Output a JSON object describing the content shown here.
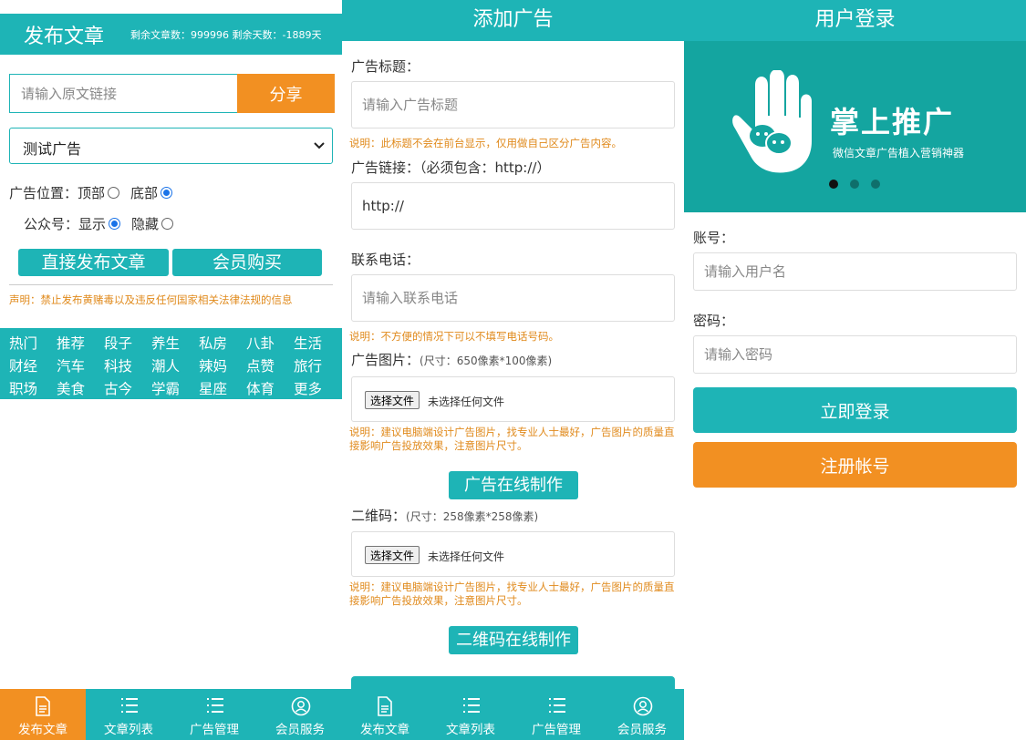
{
  "colors": {
    "teal": "#1eb4b6",
    "orange": "#f29022",
    "notice": "#e08a1c"
  },
  "publish": {
    "title": "发布文章",
    "stats": "剩余文章数：999996 剩余天数：-1889天",
    "link_placeholder": "请输入原文链接",
    "share_label": "分享",
    "ad_selected": "测试广告",
    "ad_position_label": "广告位置：",
    "ad_position_top": "顶部",
    "ad_position_bottom": "底部",
    "ad_position_selected": "底部",
    "account_label": "公众号：",
    "account_show": "显示",
    "account_hide": "隐藏",
    "account_selected": "显示",
    "publish_btn": "直接发布文章",
    "member_btn": "会员购买",
    "notice": "声明：禁止发布黄赌毒以及违反任何国家相关法律法规的信息",
    "categories": [
      [
        "热门",
        "推荐",
        "段子",
        "养生",
        "私房",
        "八卦",
        "生活"
      ],
      [
        "财经",
        "汽车",
        "科技",
        "潮人",
        "辣妈",
        "点赞",
        "旅行"
      ],
      [
        "职场",
        "美食",
        "古今",
        "学霸",
        "星座",
        "体育",
        "更多"
      ]
    ]
  },
  "add_ad": {
    "title": "添加广告",
    "ad_title_label": "广告标题：",
    "ad_title_placeholder": "请输入广告标题",
    "ad_title_hint": "说明：此标题不会在前台显示，仅用做自己区分广告内容。",
    "ad_link_label": "广告链接：（必须包含：http://）",
    "ad_link_value": "http://",
    "phone_label": "联系电话：",
    "phone_placeholder": "请输入联系电话",
    "phone_hint": "说明：不方便的情况下可以不填写电话号码。",
    "image_label": "广告图片：",
    "image_size": "(尺寸：650像素*100像素)",
    "choose_file": "选择文件",
    "no_file": "未选择任何文件",
    "image_hint": "说明：建议电脑端设计广告图片，找专业人士最好，广告图片的质量直接影响广告投放效果，注意图片尺寸。",
    "online_ad_btn": "广告在线制作",
    "qr_label": "二维码：",
    "qr_size": "(尺寸：258像素*258像素)",
    "qr_hint": "说明：建议电脑端设计广告图片，找专业人士最好，广告图片的质量直接影响广告投放效果，注意图片尺寸。",
    "online_qr_btn": "二维码在线制作"
  },
  "login": {
    "title": "用户登录",
    "brand": "掌上推广",
    "tagline": "微信文章广告植入营销神器",
    "carousel_active": 1,
    "carousel_count": 3,
    "account_label": "账号：",
    "account_placeholder": "请输入用户名",
    "password_label": "密码：",
    "password_placeholder": "请输入密码",
    "login_btn": "立即登录",
    "register_btn": "注册帐号"
  },
  "nav": {
    "items": [
      {
        "label": "发布文章",
        "icon": "document-icon"
      },
      {
        "label": "文章列表",
        "icon": "list-icon"
      },
      {
        "label": "广告管理",
        "icon": "list-icon"
      },
      {
        "label": "会员服务",
        "icon": "user-circle-icon"
      }
    ],
    "panel1_active": 0
  }
}
